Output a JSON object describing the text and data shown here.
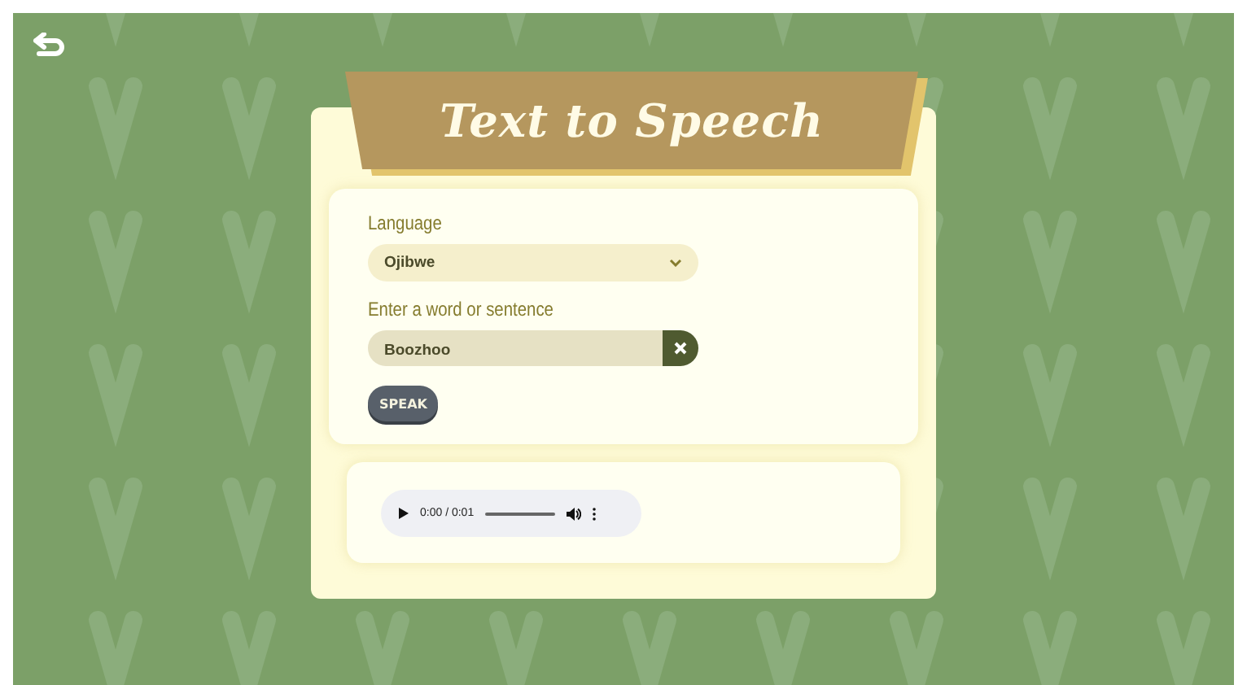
{
  "title": "Text to Speech",
  "language": {
    "label": "Language",
    "value": "Ojibwe"
  },
  "entry": {
    "label": "Enter a word or sentence",
    "value": "Boozhoo"
  },
  "speak_button": "SPEAK",
  "audio": {
    "time": "0:00 / 0:01"
  }
}
